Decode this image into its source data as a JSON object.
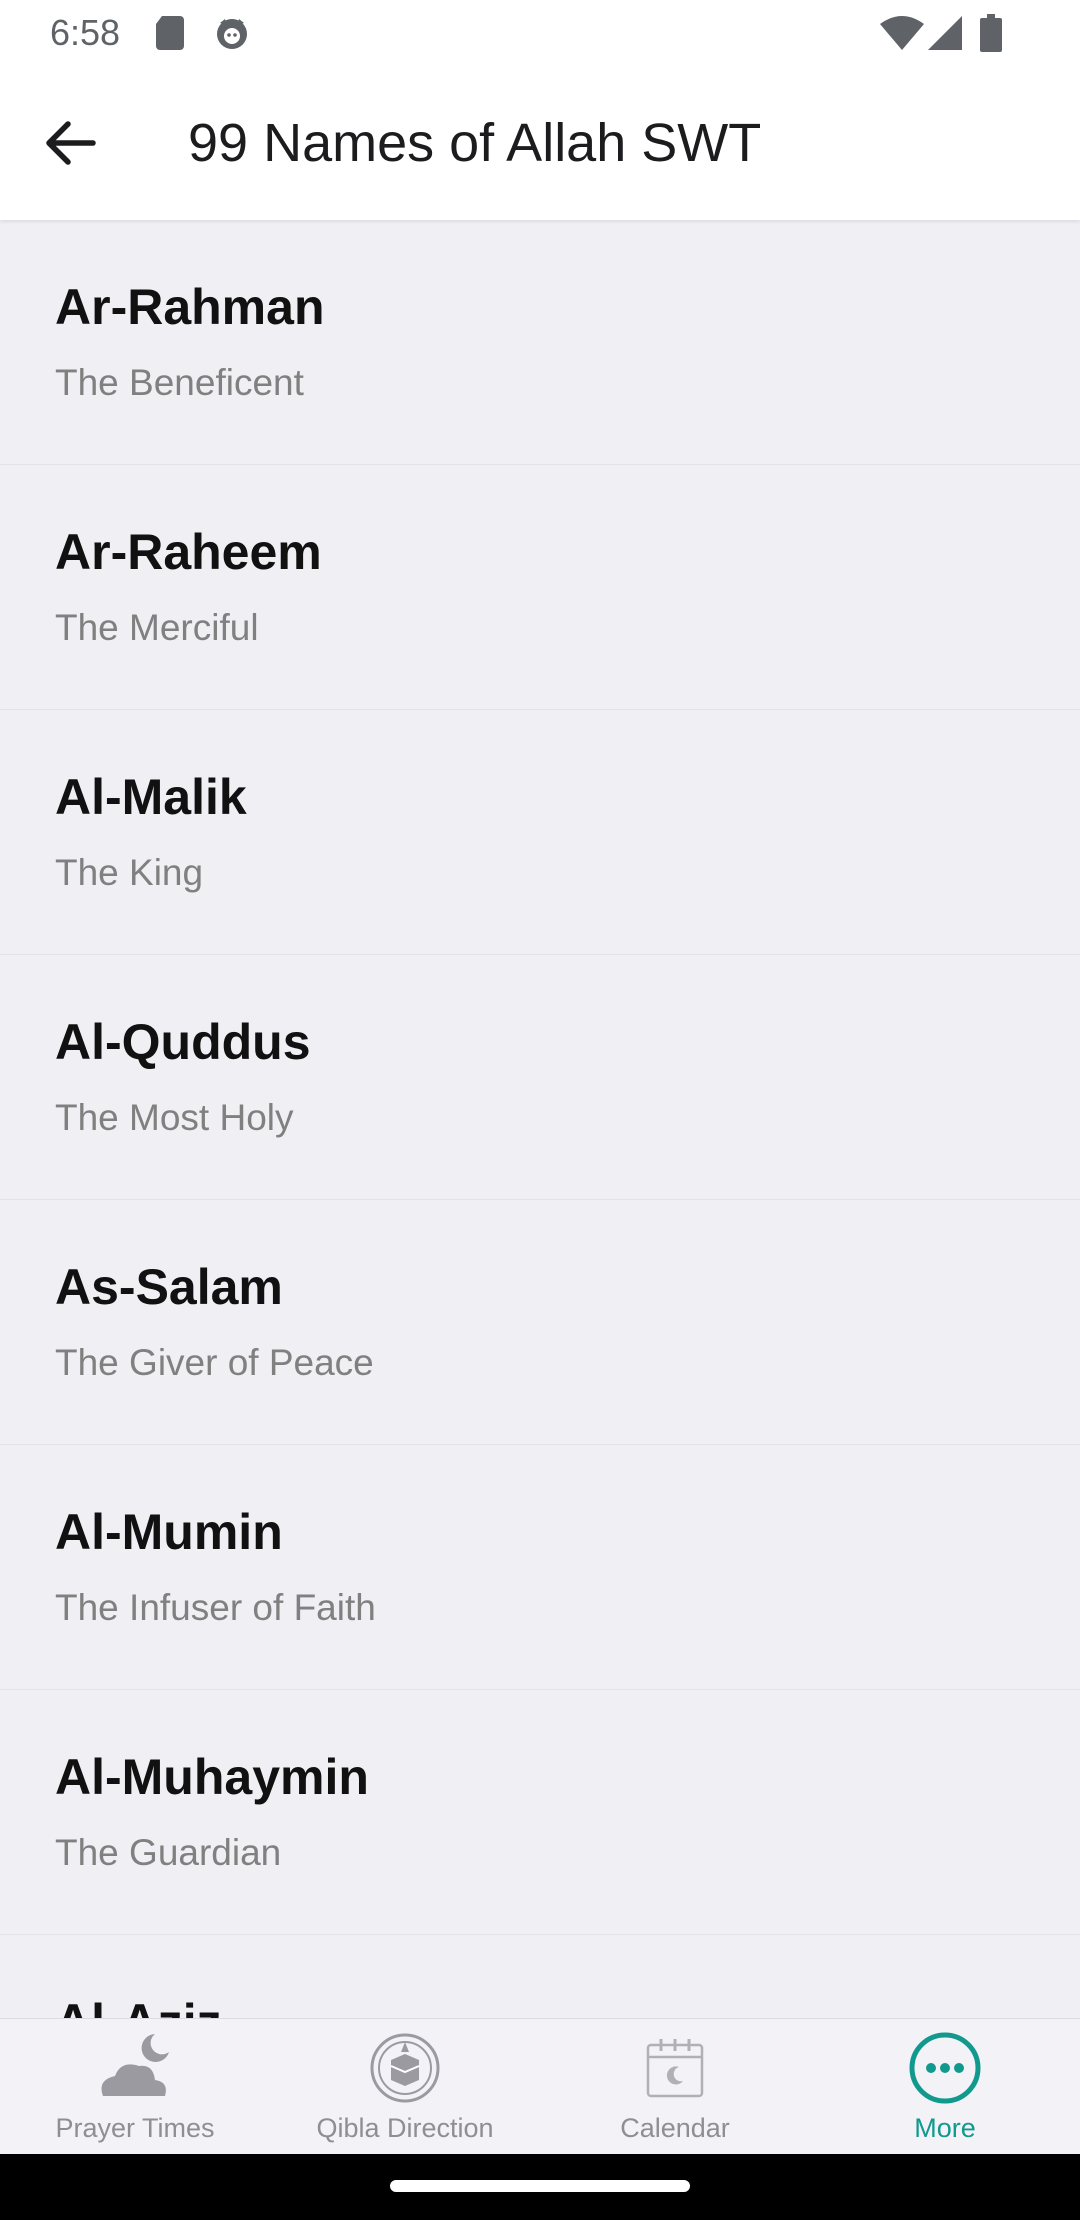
{
  "status_bar": {
    "time": "6:58",
    "icons": [
      "sd-card-icon",
      "cat-notification-icon",
      "wifi-icon",
      "signal-icon",
      "battery-icon"
    ]
  },
  "app_bar": {
    "title": "99 Names of Allah SWT",
    "back_icon": "arrow-left-icon"
  },
  "names": [
    {
      "name": "Ar-Rahman",
      "meaning": "The Beneficent"
    },
    {
      "name": "Ar-Raheem",
      "meaning": "The Merciful"
    },
    {
      "name": "Al-Malik",
      "meaning": "The King"
    },
    {
      "name": "Al-Quddus",
      "meaning": "The Most Holy"
    },
    {
      "name": "As-Salam",
      "meaning": "The Giver of Peace"
    },
    {
      "name": "Al-Mumin",
      "meaning": "The Infuser of Faith"
    },
    {
      "name": "Al-Muhaymin",
      "meaning": "The Guardian"
    },
    {
      "name": "Al-Aziz",
      "meaning": ""
    }
  ],
  "bottom_nav": {
    "items": [
      {
        "label": "Prayer Times",
        "icon": "moon-cloud-icon",
        "active": false
      },
      {
        "label": "Qibla Direction",
        "icon": "kaaba-compass-icon",
        "active": false
      },
      {
        "label": "Calendar",
        "icon": "calendar-icon",
        "active": false
      },
      {
        "label": "More",
        "icon": "more-dots-icon",
        "active": true
      }
    ]
  },
  "colors": {
    "accent": "#11998e",
    "background": "#efeff4",
    "inactive": "#8e8e93"
  }
}
